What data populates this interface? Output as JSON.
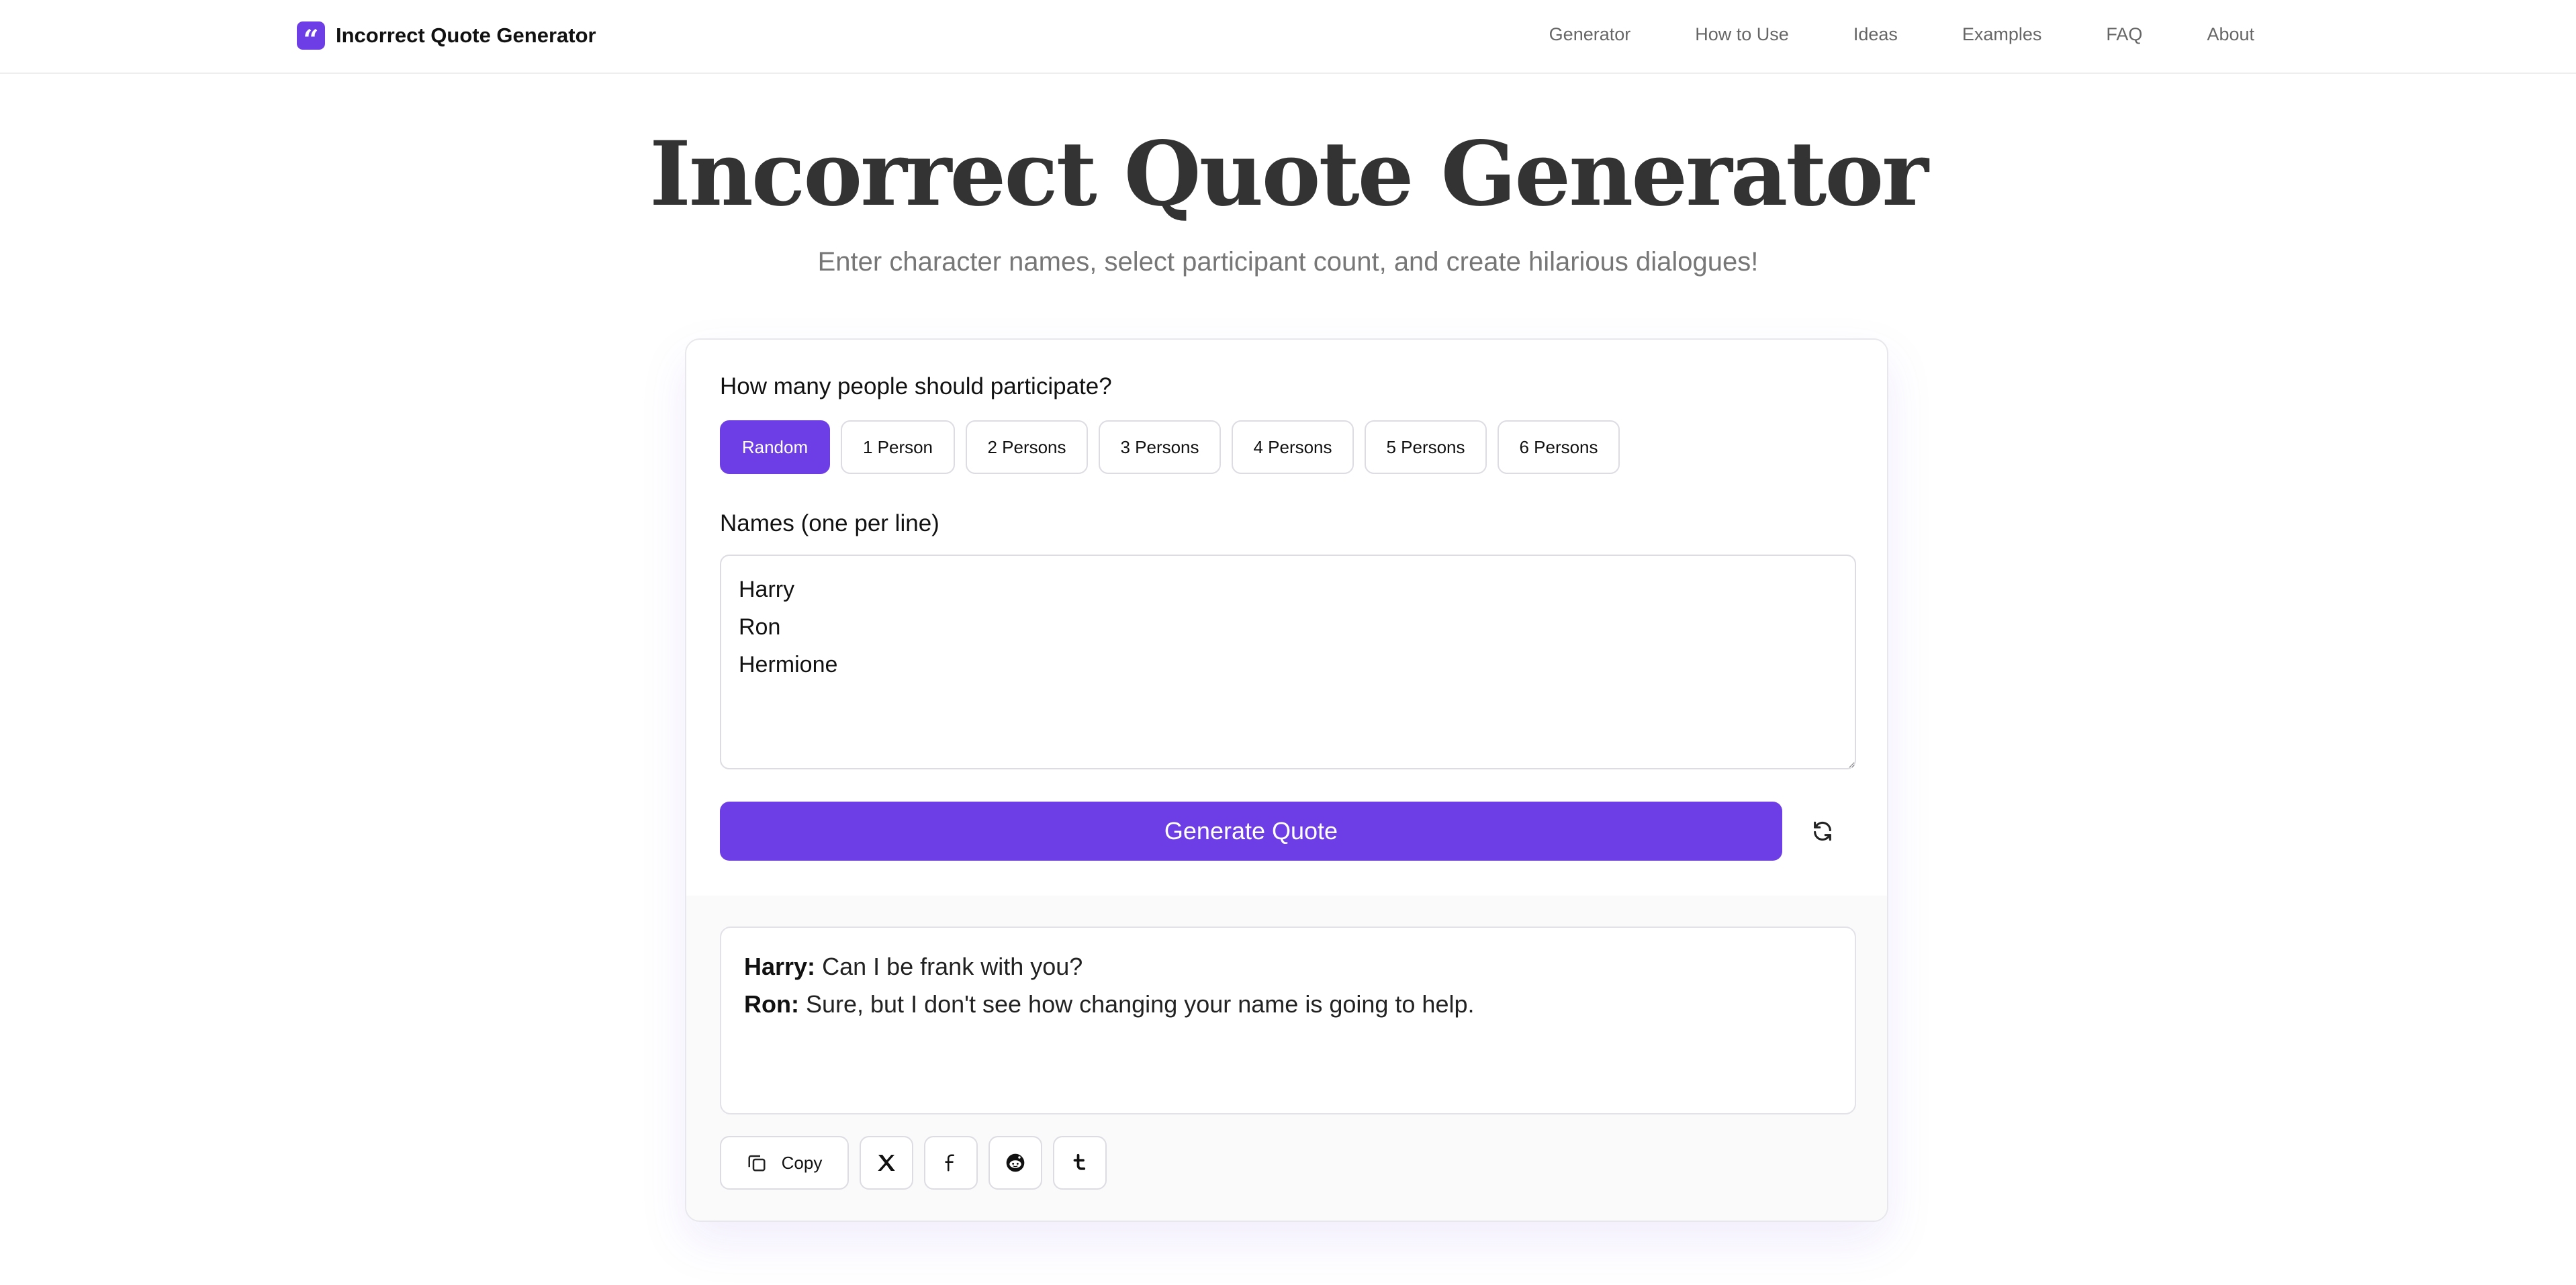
{
  "app": {
    "brand_icon_glyph": "“",
    "brand_name": "Incorrect Quote Generator",
    "accent_color": "#6d3ee6"
  },
  "nav": {
    "links": [
      "Generator",
      "How to Use",
      "Ideas",
      "Examples",
      "FAQ",
      "About"
    ]
  },
  "hero": {
    "title": "Incorrect Quote Generator",
    "subtitle": "Enter character names, select participant count, and create hilarious dialogues!"
  },
  "participants": {
    "label": "How many people should participate?",
    "options": [
      "Random",
      "1 Person",
      "2 Persons",
      "3 Persons",
      "4 Persons",
      "5 Persons",
      "6 Persons"
    ],
    "selected": "Random"
  },
  "names": {
    "label": "Names (one per line)",
    "value": "Harry\nRon\nHermione"
  },
  "actions": {
    "generate_label": "Generate Quote",
    "refresh_icon": "refresh-icon"
  },
  "output": {
    "lines": [
      {
        "speaker": "Harry:",
        "text": " Can I be frank with you?"
      },
      {
        "speaker": "Ron:",
        "text": " Sure, but I don't see how changing your name is going to help."
      }
    ]
  },
  "share": {
    "copy_label": "Copy",
    "icons": [
      "copy-icon",
      "x-twitter-icon",
      "facebook-icon",
      "reddit-icon",
      "tumblr-icon"
    ]
  }
}
